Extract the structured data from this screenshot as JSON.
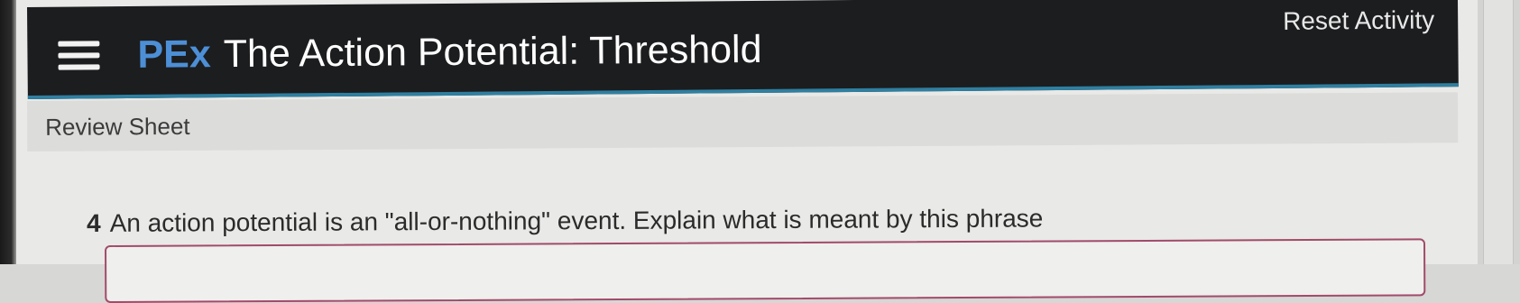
{
  "header": {
    "menu_icon": "hamburger-menu-icon",
    "brand": "PEx",
    "title": "The Action Potential: Threshold",
    "reset_label": "Reset Activity"
  },
  "review": {
    "label": "Review Sheet"
  },
  "question": {
    "number": "4",
    "text": "An action potential is an \"all-or-nothing\" event. Explain what is meant by this phrase"
  },
  "colors": {
    "header_bg": "#1c1d1f",
    "brand": "#4d8fd6",
    "accent": "#2f7fa0",
    "answer_border": "#a14b6a"
  }
}
